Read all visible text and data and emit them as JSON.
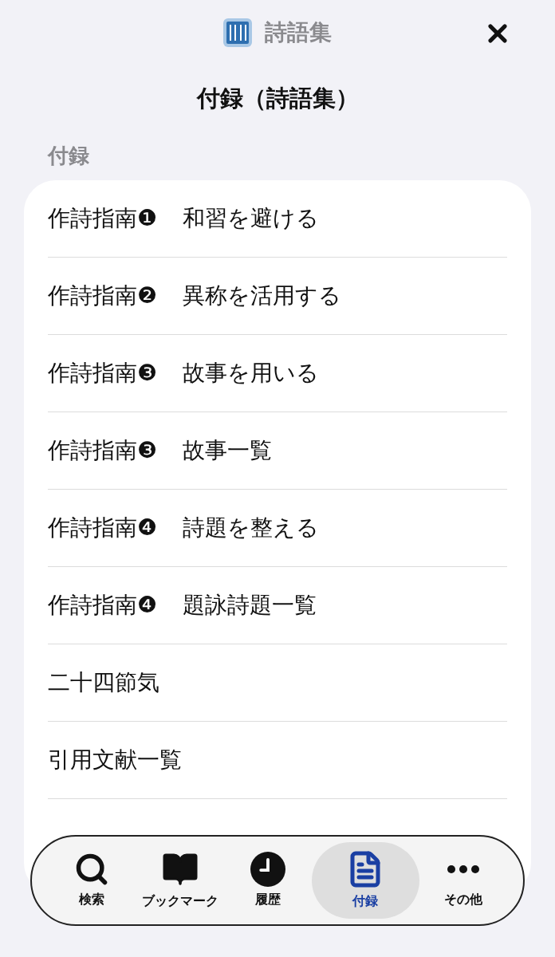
{
  "header": {
    "app_name": "詩語集"
  },
  "page_title": "付録（詩語集）",
  "section_label": "付録",
  "rows": [
    {
      "label": "作詩指南❶",
      "title": "和習を避ける"
    },
    {
      "label": "作詩指南❷",
      "title": "異称を活用する"
    },
    {
      "label": "作詩指南❸",
      "title": "故事を用いる"
    },
    {
      "label": "作詩指南❸",
      "title": "故事一覧"
    },
    {
      "label": "作詩指南❹",
      "title": "詩題を整える"
    },
    {
      "label": "作詩指南❹",
      "title": "題詠詩題一覧"
    },
    {
      "label": "二十四節気"
    },
    {
      "label": "引用文献一覧"
    }
  ],
  "tab_bar": [
    {
      "kind": "search",
      "label": "検索",
      "selected": false
    },
    {
      "kind": "bookmark",
      "label": "ブックマーク",
      "selected": false
    },
    {
      "kind": "history",
      "label": "履歴",
      "selected": false
    },
    {
      "kind": "appendix",
      "label": "付録",
      "selected": true
    },
    {
      "kind": "more",
      "label": "その他",
      "selected": false
    }
  ]
}
